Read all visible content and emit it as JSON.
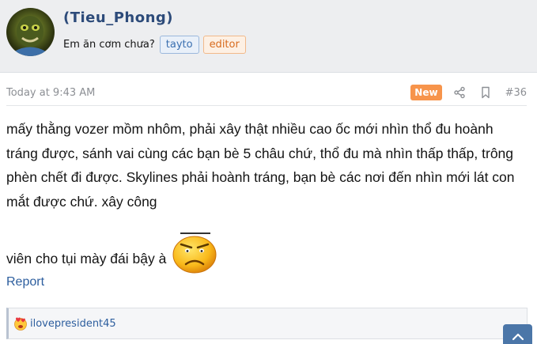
{
  "user": {
    "name": "(Tieu_Phong)",
    "title": "Em ăn cơm chưa?",
    "badges": [
      "tayto",
      "editor"
    ]
  },
  "post": {
    "time": "Today at 9:43 AM",
    "new_label": "New",
    "number": "#36",
    "text_line1": "mấy thằng vozer mồm nhôm, phải xây thật nhiều cao ốc mới nhìn thổ đu hoành tráng được, sánh vai cùng các bạn bè 5 châu chứ, thổ đu mà nhìn thấp thấp, trông phèn chết đi được. Skylines phải hoành tráng, bạn bè các nơi đến nhìn mới lát con mắt được chứ. xây công",
    "text_line2": "viên cho tụi mày đái bậy à",
    "smiley": "sad-smiley-icon"
  },
  "actions": {
    "report": "Report"
  },
  "reactions": {
    "icon": "love-reaction-icon",
    "users": "ilovepresident45"
  },
  "colors": {
    "username": "#2d4b7a",
    "new_badge": "#f7944b",
    "link": "#2d5e9e",
    "scroll_button": "#4b76a8"
  }
}
